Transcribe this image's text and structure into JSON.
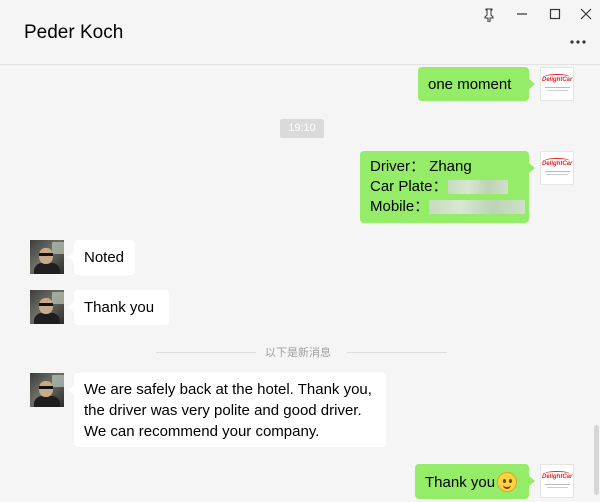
{
  "window": {
    "title": "Peder Koch",
    "pin_icon": "pin-icon",
    "minimize_icon": "minimize-icon",
    "maximize_icon": "maximize-icon",
    "close_icon": "close-icon",
    "more_icon": "more-options-icon"
  },
  "chat": {
    "messages": [
      {
        "side": "right",
        "text": "one moment"
      },
      {
        "side": "right",
        "driver_label": "Driver：",
        "driver_value": "Zhang",
        "plate_label": "Car Plate：",
        "mobile_label": "Mobile："
      },
      {
        "side": "left",
        "text": "Noted"
      },
      {
        "side": "left",
        "text": "Thank you"
      },
      {
        "side": "left",
        "lines": [
          "We are safely back at the hotel. Thank you,",
          "the driver was very polite and good driver.",
          "We can recommend your company."
        ]
      },
      {
        "side": "right",
        "text": "Thank you"
      }
    ],
    "timestamp": "19:10",
    "new_messages_divider": "以下是新消息",
    "avatar_logo": "DelightCar"
  },
  "colors": {
    "sent_bubble": "#95ec69",
    "received_bubble": "#ffffff",
    "background": "#f5f5f5"
  }
}
